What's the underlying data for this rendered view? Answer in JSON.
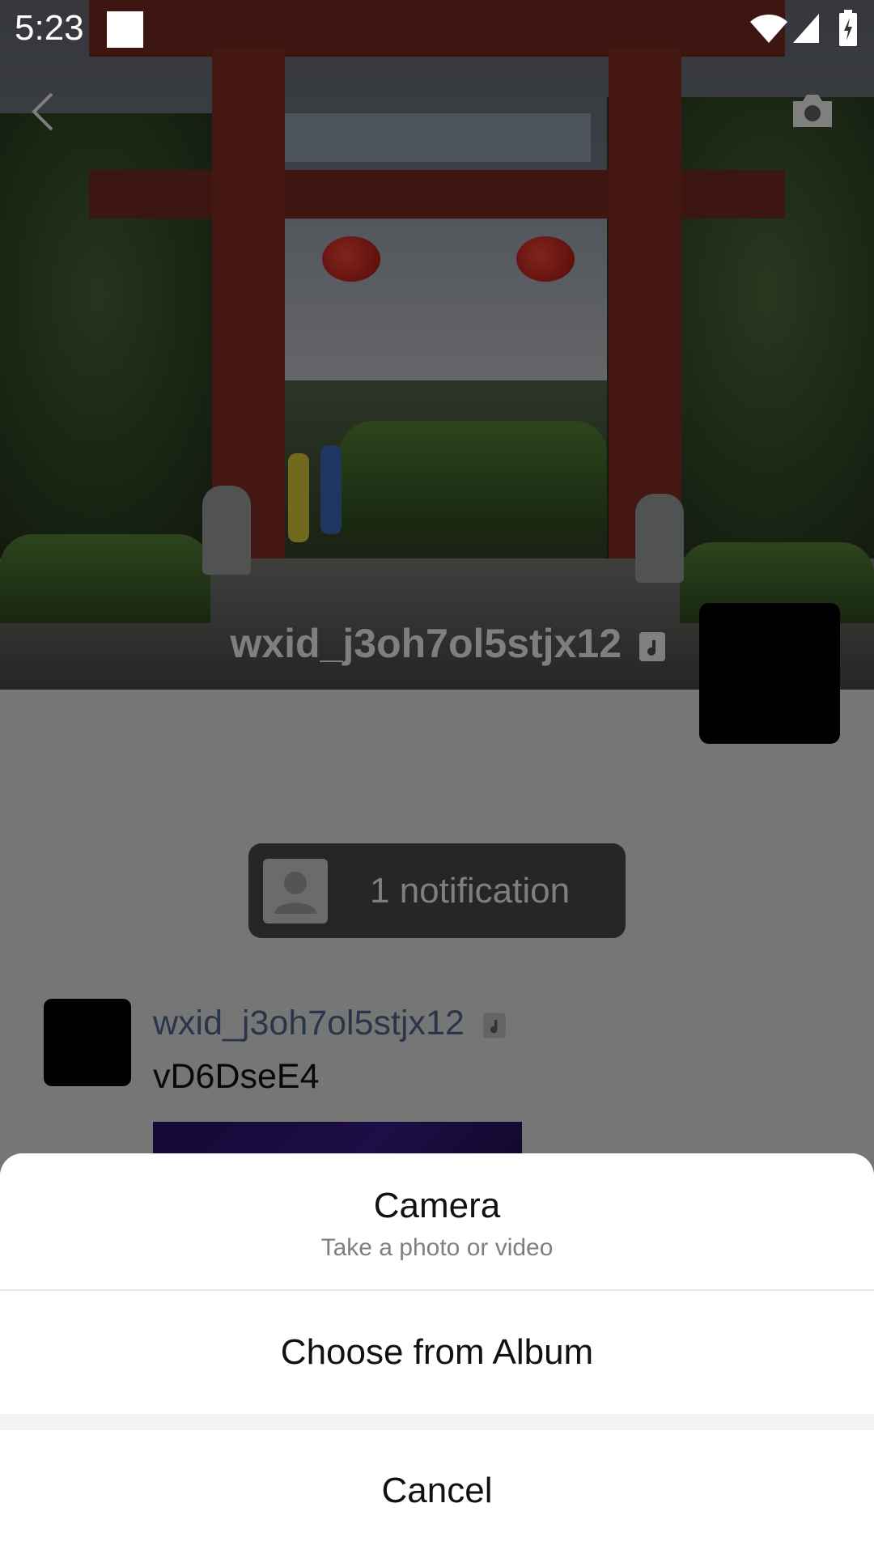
{
  "status_bar": {
    "time": "5:23"
  },
  "profile": {
    "name": "wxid_j3oh7ol5stjx12"
  },
  "notification": {
    "text": "1 notification"
  },
  "post": {
    "author": "wxid_j3oh7ol5stjx12",
    "text": "vD6DseE4"
  },
  "action_sheet": {
    "camera_title": "Camera",
    "camera_subtitle": "Take a photo or video",
    "album_label": "Choose from Album",
    "cancel_label": "Cancel"
  }
}
